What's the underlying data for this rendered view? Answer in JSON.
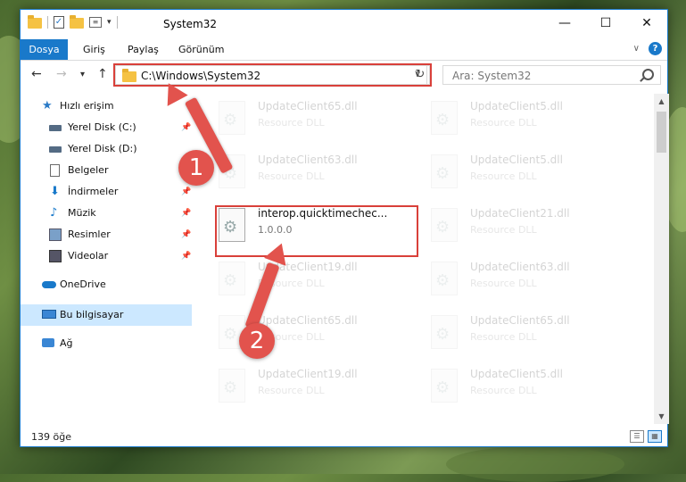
{
  "window": {
    "title": "System32",
    "min_glyph": "—",
    "max_glyph": "☐",
    "close_glyph": "✕"
  },
  "ribbon": {
    "tabs": [
      "Dosya",
      "Giriş",
      "Paylaş",
      "Görünüm"
    ],
    "accent": "#1979ca"
  },
  "nav": {
    "back": "←",
    "forward": "→",
    "recent": "▾",
    "up": "↑",
    "address": "C:\\Windows\\System32",
    "search_placeholder": "Ara: System32"
  },
  "sidebar": {
    "quick_access": "Hızlı erişim",
    "items": [
      {
        "label": "Yerel Disk (C:)",
        "icon": "drive-icon"
      },
      {
        "label": "Yerel Disk (D:)",
        "icon": "drive-icon"
      },
      {
        "label": "Belgeler",
        "icon": "documents-icon"
      },
      {
        "label": "İndirmeler",
        "icon": "downloads-icon"
      },
      {
        "label": "Müzik",
        "icon": "music-icon"
      },
      {
        "label": "Resimler",
        "icon": "pictures-icon"
      },
      {
        "label": "Videolar",
        "icon": "videos-icon"
      }
    ],
    "onedrive": "OneDrive",
    "this_pc": "Bu bilgisayar",
    "network": "Ağ"
  },
  "files": {
    "left": [
      {
        "name": "UpdateClient65.dll",
        "sub": "Resource DLL"
      },
      {
        "name": "UpdateClient63.dll",
        "sub": "Resource DLL"
      },
      {
        "name": "interop.quicktimechec...",
        "sub": "1.0.0.0"
      },
      {
        "name": "UpdateClient19.dll",
        "sub": "Resource DLL"
      },
      {
        "name": "UpdateClient65.dll",
        "sub": "Resource DLL"
      },
      {
        "name": "UpdateClient19.dll",
        "sub": "Resource DLL"
      }
    ],
    "right": [
      {
        "name": "UpdateClient5.dll",
        "sub": "Resource DLL"
      },
      {
        "name": "UpdateClient5.dll",
        "sub": "Resource DLL"
      },
      {
        "name": "UpdateClient21.dll",
        "sub": "Resource DLL"
      },
      {
        "name": "UpdateClient63.dll",
        "sub": "Resource DLL"
      },
      {
        "name": "UpdateClient65.dll",
        "sub": "Resource DLL"
      },
      {
        "name": "UpdateClient5.dll",
        "sub": "Resource DLL"
      }
    ]
  },
  "status": {
    "count": "139 öğe"
  },
  "annotations": {
    "step1": "1",
    "step2": "2",
    "color": "#e2534d"
  }
}
